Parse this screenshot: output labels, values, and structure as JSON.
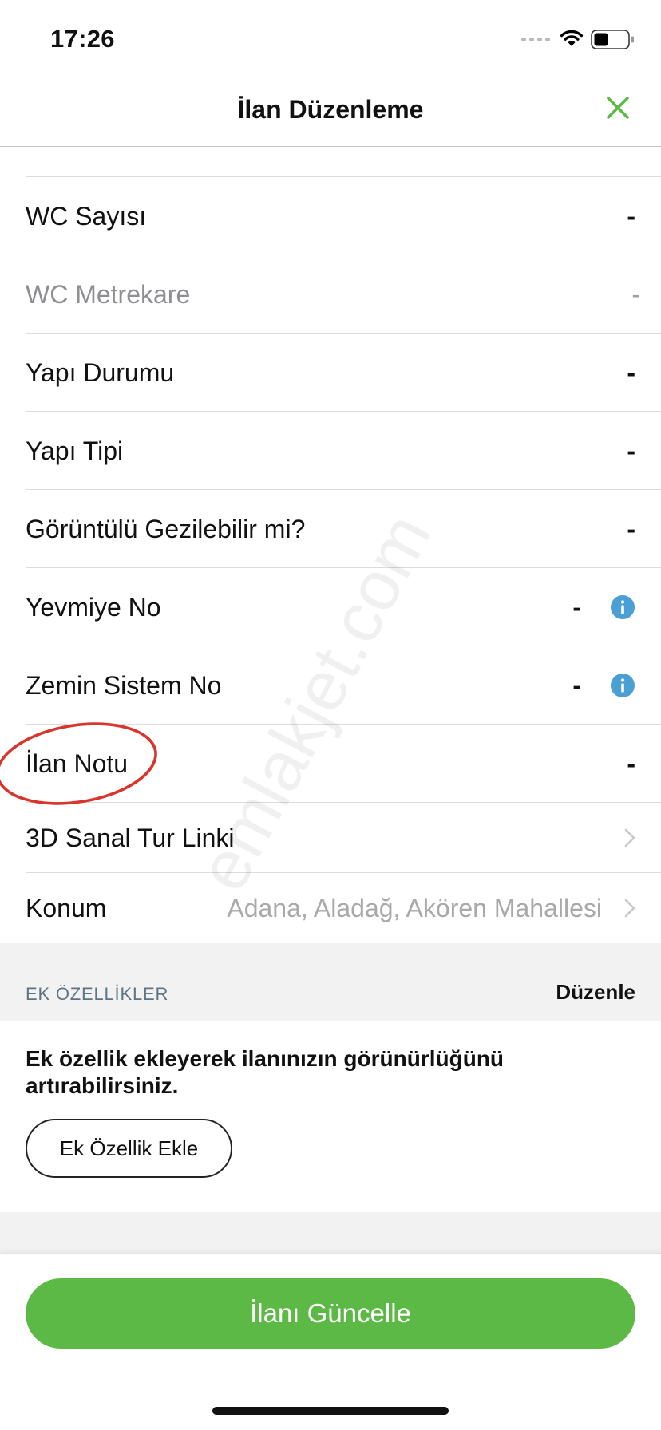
{
  "status_bar": {
    "time": "17:26",
    "icons": [
      "signal-dots-icon",
      "wifi-icon",
      "battery-icon"
    ]
  },
  "nav": {
    "title": "İlan Düzenleme",
    "close_icon": "close-icon"
  },
  "rows": [
    {
      "label": "WC Sayısı",
      "value": "-"
    },
    {
      "label": "WC Metrekare",
      "value": "-",
      "disabled": true
    },
    {
      "label": "Yapı Durumu",
      "value": "-"
    },
    {
      "label": "Yapı Tipi",
      "value": "-"
    },
    {
      "label": "Görüntülü Gezilebilir mi?",
      "value": "-"
    },
    {
      "label": "Yevmiye No",
      "value": "-",
      "icon": "info-icon"
    },
    {
      "label": "Zemin Sistem No",
      "value": "-",
      "icon": "info-icon"
    },
    {
      "label": "İlan Notu",
      "value": "-"
    },
    {
      "label": "3D Sanal Tur Linki",
      "icon": "chevron-right-icon"
    },
    {
      "label": "Konum",
      "value": "Adana, Aladağ, Akören Mahallesi",
      "icon": "chevron-right-icon"
    }
  ],
  "extras": {
    "section_title": "EK ÖZELLİKLER",
    "edit_label": "Düzenle",
    "description": "Ek özellik ekleyerek ilanınızın görünürlüğünü artırabilirsiniz.",
    "add_button_label": "Ek Özellik Ekle"
  },
  "footer": {
    "update_button_label": "İlanı Güncelle"
  },
  "watermark": "emlakjet.com",
  "colors": {
    "accent": "#5cb946",
    "info": "#4a9fd5",
    "section_title": "#5d7483",
    "annotation": "#d8352c"
  }
}
